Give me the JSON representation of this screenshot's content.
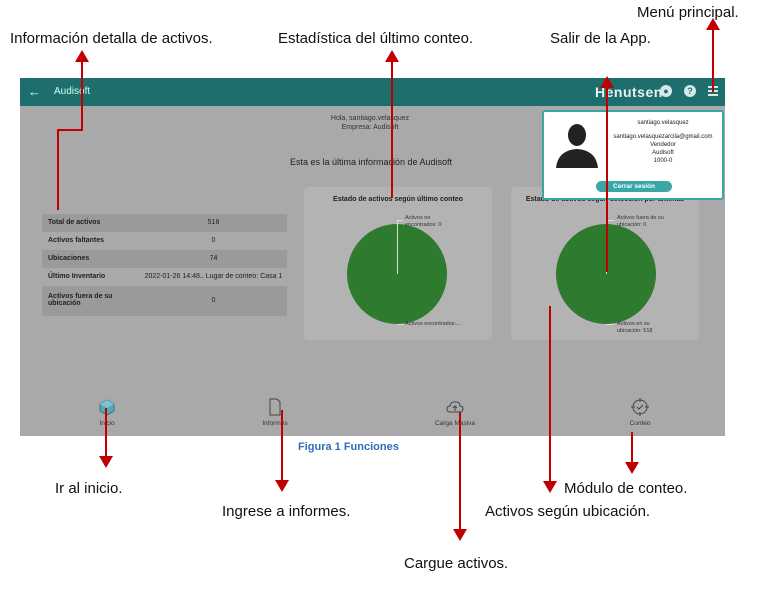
{
  "annotations": {
    "info_activos": "Información detalla de activos.",
    "estadistica": "Estadística del último conteo.",
    "salir": "Salir de la App.",
    "menu": "Menú principal.",
    "inicio": "Ir al inicio.",
    "informes": "Ingrese a informes.",
    "cargue": "Cargue activos.",
    "ubicacion": "Activos según ubicación.",
    "conteo": "Módulo de conteo."
  },
  "app": {
    "back_icon": "←",
    "title": "Audisoft",
    "brand": "Henutsen"
  },
  "greeting": {
    "line1": "Hola, santiago.velasquez",
    "line2": "Empresa: Audisoft"
  },
  "info_title": "Esta es la última información de Audisoft",
  "table": [
    {
      "label": "Total de activos",
      "value": "518"
    },
    {
      "label": "Activos faltantes",
      "value": "0"
    },
    {
      "label": "Ubicaciones",
      "value": "74"
    },
    {
      "label": "Último Inventario",
      "value": "2022-01-26 14:48.. Lugar de conteo: Casa 1"
    },
    {
      "label": "Activos fuera de su ubicación",
      "value": "0"
    }
  ],
  "cards": {
    "left": {
      "title": "Estado de activos según último conteo",
      "label_top": "Activos no encontrados: 0",
      "label_bottom": "Activos encontrados:..."
    },
    "right": {
      "title": "Estado de activos según detección por antenas",
      "label_top": "Activos fuera de su ubicación: 0",
      "label_bottom": "Activos en su ubicación: 518"
    }
  },
  "popup": {
    "name": "santiago.velasquez",
    "email": "santiago.velasquezarcila@gmail.com",
    "role": "Vendedor",
    "company": "Audisoft",
    "code": "1000-0",
    "logout": "Cerrar sesión"
  },
  "nav": {
    "inicio": "Inicio",
    "informes": "Informes",
    "carga": "Carga Masiva",
    "conteo": "Conteo"
  },
  "figure_caption": "Figura 1 Funciones",
  "colors": {
    "topbar": "#1f6e6e",
    "accent": "#3aa6a6",
    "pie": "#2e7a2e",
    "arrow": "#c00000",
    "caption": "#2e6fb5"
  }
}
